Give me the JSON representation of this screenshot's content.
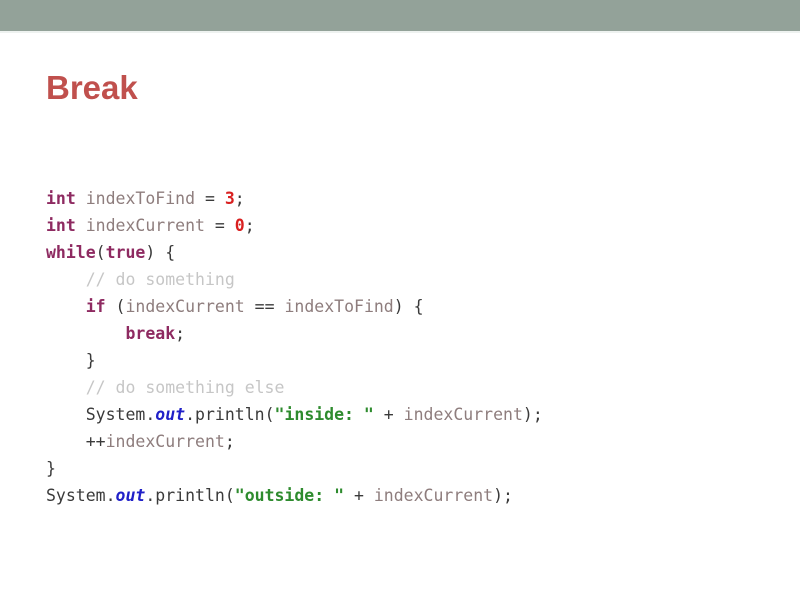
{
  "slide": {
    "title": "Break",
    "title_color": "#c0504d",
    "background_color": "#ffffff",
    "top_bar_color": "#93a299"
  },
  "syntax_colors": {
    "keyword": "#8e2a61",
    "number": "#d92020",
    "identifier": "#8e7d7d",
    "comment": "#c6c6c6",
    "string": "#2e8b2e",
    "punctuation": "#3a3a3a",
    "field": "#2020c8"
  },
  "code": {
    "language": "java",
    "plain_text": "int indexToFind = 3;\nint indexCurrent = 0;\nwhile(true) {\n    // do something\n    if (indexCurrent == indexToFind) {\n        break;\n    }\n    // do something else\n    System.out.println(\"inside: \" + indexCurrent);\n    ++indexCurrent;\n}\nSystem.out.println(\"outside: \" + indexCurrent);",
    "lines": [
      {
        "indent": "",
        "tokens": [
          {
            "t": "int",
            "c": "tok-kw"
          },
          {
            "t": " ",
            "c": "tok-plain"
          },
          {
            "t": "indexToFind",
            "c": "tok-id"
          },
          {
            "t": " = ",
            "c": "tok-punct"
          },
          {
            "t": "3",
            "c": "tok-num"
          },
          {
            "t": ";",
            "c": "tok-punct"
          }
        ]
      },
      {
        "indent": "",
        "tokens": [
          {
            "t": "int",
            "c": "tok-kw"
          },
          {
            "t": " ",
            "c": "tok-plain"
          },
          {
            "t": "indexCurrent",
            "c": "tok-id"
          },
          {
            "t": " = ",
            "c": "tok-punct"
          },
          {
            "t": "0",
            "c": "tok-num"
          },
          {
            "t": ";",
            "c": "tok-punct"
          }
        ]
      },
      {
        "indent": "",
        "tokens": [
          {
            "t": "while",
            "c": "tok-kw"
          },
          {
            "t": "(",
            "c": "tok-punct"
          },
          {
            "t": "true",
            "c": "tok-kw"
          },
          {
            "t": ") {",
            "c": "tok-punct"
          }
        ]
      },
      {
        "indent": "    ",
        "tokens": [
          {
            "t": "// do something",
            "c": "tok-com"
          }
        ]
      },
      {
        "indent": "    ",
        "tokens": [
          {
            "t": "if",
            "c": "tok-kw"
          },
          {
            "t": " (",
            "c": "tok-punct"
          },
          {
            "t": "indexCurrent",
            "c": "tok-id"
          },
          {
            "t": " == ",
            "c": "tok-punct"
          },
          {
            "t": "indexToFind",
            "c": "tok-id"
          },
          {
            "t": ") {",
            "c": "tok-punct"
          }
        ]
      },
      {
        "indent": "        ",
        "tokens": [
          {
            "t": "break",
            "c": "tok-kw"
          },
          {
            "t": ";",
            "c": "tok-punct"
          }
        ]
      },
      {
        "indent": "    ",
        "tokens": [
          {
            "t": "}",
            "c": "tok-punct"
          }
        ]
      },
      {
        "indent": "    ",
        "tokens": [
          {
            "t": "// do something else",
            "c": "tok-com"
          }
        ]
      },
      {
        "indent": "    ",
        "tokens": [
          {
            "t": "System",
            "c": "tok-punct"
          },
          {
            "t": ".",
            "c": "tok-punct"
          },
          {
            "t": "out",
            "c": "tok-field"
          },
          {
            "t": ".println(",
            "c": "tok-punct"
          },
          {
            "t": "\"inside: \"",
            "c": "tok-str"
          },
          {
            "t": " + ",
            "c": "tok-punct"
          },
          {
            "t": "indexCurrent",
            "c": "tok-id"
          },
          {
            "t": ");",
            "c": "tok-punct"
          }
        ]
      },
      {
        "indent": "    ",
        "tokens": [
          {
            "t": "++",
            "c": "tok-punct"
          },
          {
            "t": "indexCurrent",
            "c": "tok-id"
          },
          {
            "t": ";",
            "c": "tok-punct"
          }
        ]
      },
      {
        "indent": "",
        "tokens": [
          {
            "t": "}",
            "c": "tok-punct"
          }
        ]
      },
      {
        "indent": "",
        "tokens": [
          {
            "t": "System",
            "c": "tok-punct"
          },
          {
            "t": ".",
            "c": "tok-punct"
          },
          {
            "t": "out",
            "c": "tok-field"
          },
          {
            "t": ".println(",
            "c": "tok-punct"
          },
          {
            "t": "\"outside: \"",
            "c": "tok-str"
          },
          {
            "t": " + ",
            "c": "tok-punct"
          },
          {
            "t": "indexCurrent",
            "c": "tok-id"
          },
          {
            "t": ");",
            "c": "tok-punct"
          }
        ]
      }
    ]
  }
}
